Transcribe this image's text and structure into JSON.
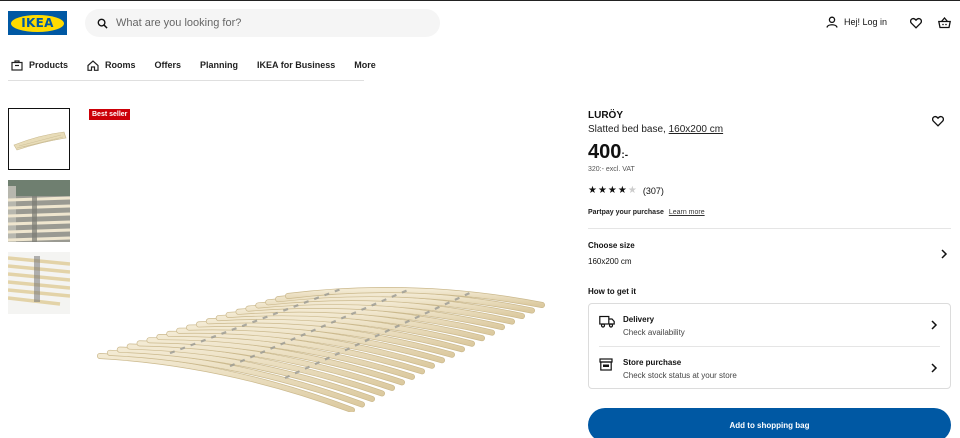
{
  "header": {
    "logo_text": "IKEA",
    "search_placeholder": "What are you looking for?",
    "login_label": "Hej! Log in",
    "brand_blue": "#0058a3",
    "brand_yellow": "#ffdb00"
  },
  "nav": {
    "items": [
      {
        "label": "Products",
        "icon": "products-icon"
      },
      {
        "label": "Rooms",
        "icon": "home-icon"
      },
      {
        "label": "Offers"
      },
      {
        "label": "Planning"
      },
      {
        "label": "IKEA for Business"
      },
      {
        "label": "More"
      }
    ]
  },
  "gallery": {
    "badge": "Best seller",
    "badge_color": "#cc0008"
  },
  "product": {
    "name": "LURÖY",
    "description": "Slatted bed base,",
    "size_link": "160x200 cm",
    "price": "400",
    "price_suffix": ":-",
    "vat_note": "320:- excl. VAT",
    "rating": 4,
    "rating_max": 5,
    "review_count": "(307)",
    "partpay_label": "Partpay your purchase",
    "partpay_link": "Learn more"
  },
  "size": {
    "title": "Choose size",
    "value": "160x200 cm"
  },
  "fulfilment": {
    "title": "How to get it",
    "options": [
      {
        "title": "Delivery",
        "subtitle": "Check availability",
        "icon": "truck-icon"
      },
      {
        "title": "Store purchase",
        "subtitle": "Check stock status at your store",
        "icon": "store-icon"
      }
    ]
  },
  "cta": {
    "label": "Add to shopping bag",
    "color": "#0058a3"
  }
}
